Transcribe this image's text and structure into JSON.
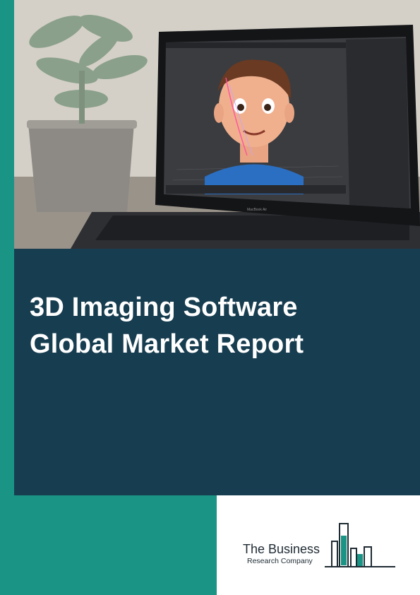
{
  "report": {
    "title_line1": "3D Imaging Software",
    "title_line2": "Global Market Report"
  },
  "publisher": {
    "name": "The Business",
    "subtitle": "Research Company"
  },
  "hero_image": {
    "laptop_label": "MacBook Air"
  },
  "colors": {
    "teal": "#1a9485",
    "navy": "#173d50",
    "white": "#ffffff"
  }
}
